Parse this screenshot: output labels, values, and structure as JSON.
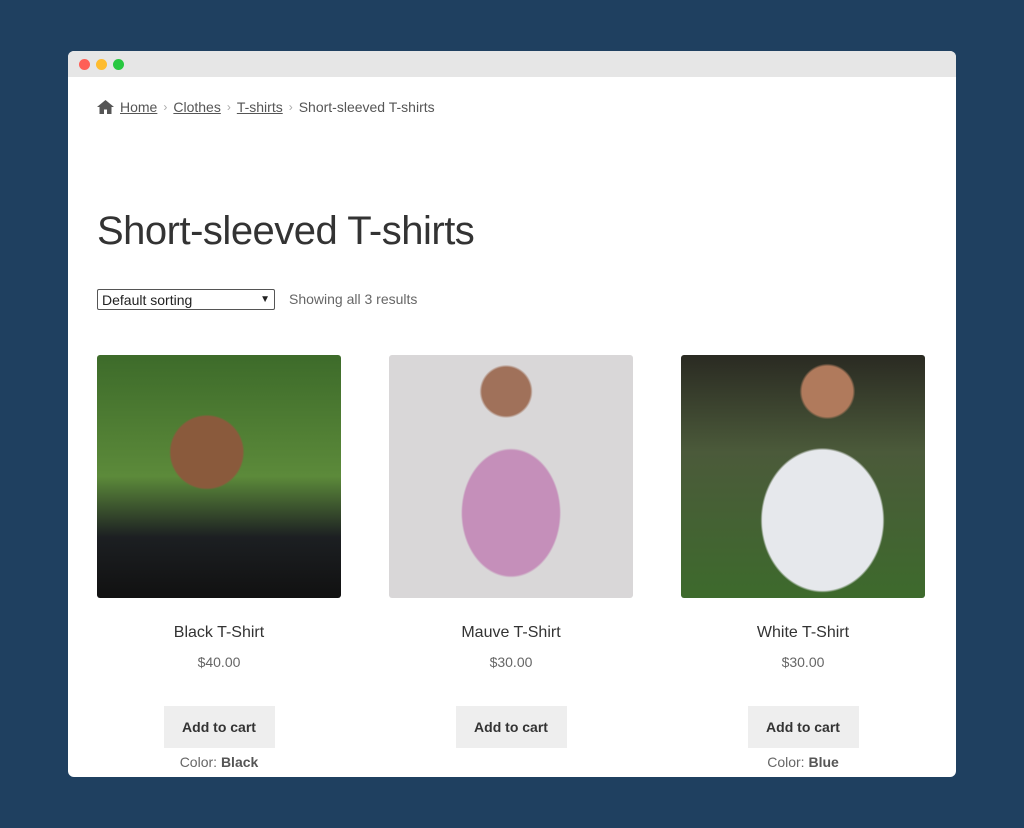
{
  "breadcrumb": {
    "items": [
      "Home",
      "Clothes",
      "T-shirts"
    ],
    "current": "Short-sleeved T-shirts"
  },
  "page_title": "Short-sleeved T-shirts",
  "sorting": {
    "selected": "Default sorting"
  },
  "result_count": "Showing all 3 results",
  "products": [
    {
      "name": "Black T-Shirt",
      "price": "$40.00",
      "button": "Add to cart",
      "color_label": "Color:",
      "color": "Black"
    },
    {
      "name": "Mauve T-Shirt",
      "price": "$30.00",
      "button": "Add to cart"
    },
    {
      "name": "White T-Shirt",
      "price": "$30.00",
      "button": "Add to cart",
      "color_label": "Color:",
      "color": "Blue"
    }
  ],
  "colors": {
    "background": "#1f4060",
    "button": "#eeeeee"
  }
}
